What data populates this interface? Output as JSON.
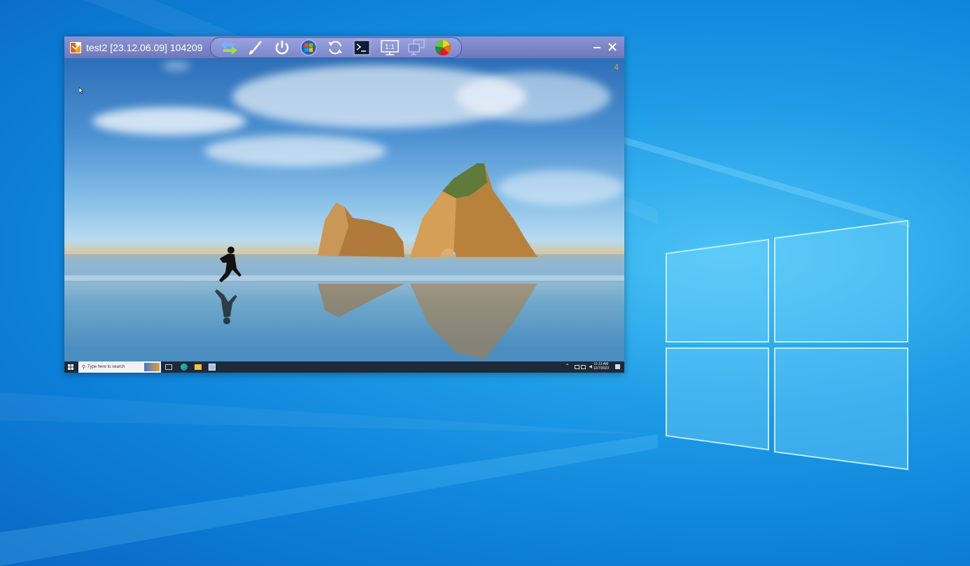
{
  "viewer": {
    "title": "test2 [23.12.06.09] 104209",
    "toolbar_icons": [
      "transfer-icon",
      "brush-icon",
      "power-icon",
      "windows-start-icon",
      "refresh-icon",
      "terminal-icon",
      "one-to-one-icon",
      "multi-monitor-icon",
      "color-wheel-icon"
    ],
    "one_to_one_label": "1:1",
    "remote_indicator": "4"
  },
  "remote_desktop": {
    "search_placeholder": "Type here to search",
    "tray_time": "11:13 AM",
    "tray_date": "12/7/2023"
  },
  "colors": {
    "titlebar": "#7a83c2",
    "desktop_blue": "#0c7fd8",
    "remote_taskbar": "#1d2a3a"
  }
}
